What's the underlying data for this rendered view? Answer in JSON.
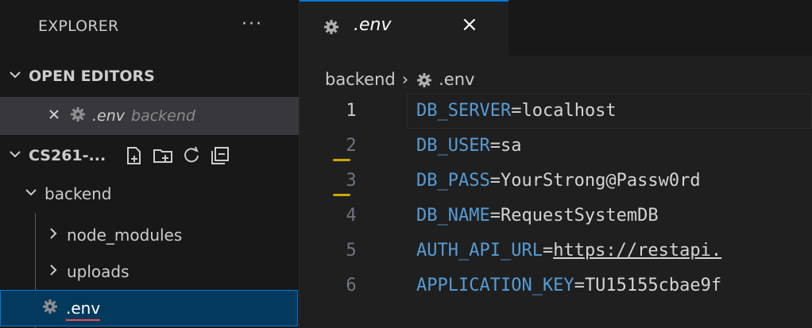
{
  "sidebar": {
    "title": "EXPLORER",
    "more": "···",
    "open_editors": {
      "label": "OPEN EDITORS",
      "file": ".env",
      "folder": "backend"
    },
    "workspace": {
      "label": "CS261-...",
      "tools": [
        "new-file-icon",
        "new-folder-icon",
        "refresh-icon",
        "collapse-all-icon"
      ]
    },
    "tree": {
      "root": "backend",
      "items": [
        {
          "label": "node_modules",
          "type": "folder"
        },
        {
          "label": "uploads",
          "type": "folder"
        },
        {
          "label": ".env",
          "type": "file"
        }
      ]
    }
  },
  "tabs": [
    {
      "label": ".env",
      "close": "×"
    }
  ],
  "breadcrumb": {
    "folder": "backend",
    "separator": "›",
    "file": ".env"
  },
  "code": [
    {
      "n": "1",
      "key": "DB_SERVER",
      "value": "localhost"
    },
    {
      "n": "2",
      "key": "DB_USER",
      "value": "sa"
    },
    {
      "n": "3",
      "key": "DB_PASS",
      "value": "YourStrong@Passw0rd"
    },
    {
      "n": "4",
      "key": "DB_NAME",
      "value": "RequestSystemDB"
    },
    {
      "n": "5",
      "key": "AUTH_API_URL",
      "value": "https://restapi."
    },
    {
      "n": "6",
      "key": "APPLICATION_KEY",
      "value": "TU15155cbae9f"
    }
  ],
  "colors": {
    "accent": "#0078d4",
    "warning": "#cca700",
    "error": "#f14c4c",
    "key": "#569cd6"
  }
}
